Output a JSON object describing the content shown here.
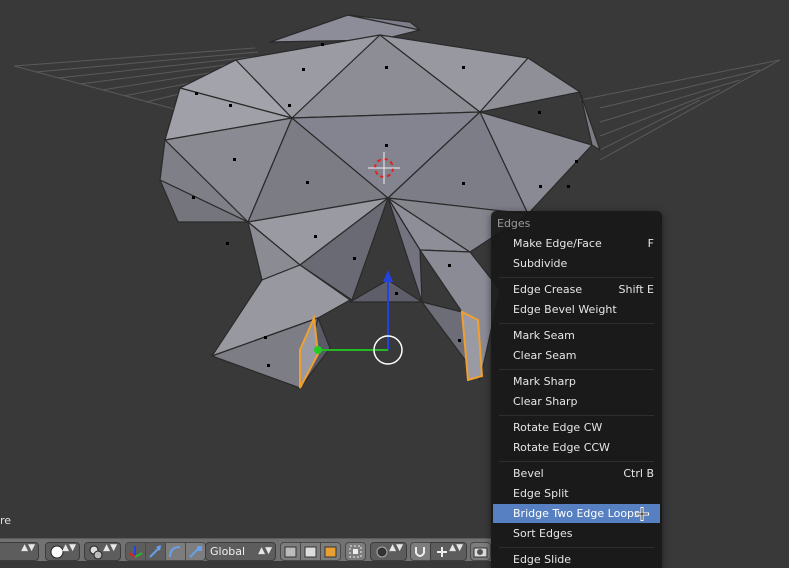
{
  "viewport": {
    "partial_label": "re"
  },
  "menu": {
    "title": "Edges",
    "items": [
      {
        "label": "Make Edge/Face",
        "shortcut": "F"
      },
      {
        "label": "Subdivide",
        "shortcut": ""
      },
      {
        "label": "Edge Crease",
        "shortcut": "Shift E"
      },
      {
        "label": "Edge Bevel Weight",
        "shortcut": ""
      },
      {
        "label": "Mark Seam",
        "shortcut": ""
      },
      {
        "label": "Clear Seam",
        "shortcut": ""
      },
      {
        "label": "Mark Sharp",
        "shortcut": ""
      },
      {
        "label": "Clear Sharp",
        "shortcut": ""
      },
      {
        "label": "Rotate Edge CW",
        "shortcut": ""
      },
      {
        "label": "Rotate Edge CCW",
        "shortcut": ""
      },
      {
        "label": "Bevel",
        "shortcut": "Ctrl B"
      },
      {
        "label": "Edge Split",
        "shortcut": ""
      },
      {
        "label": "Bridge Two Edge Loops",
        "shortcut": ""
      },
      {
        "label": "Sort Edges",
        "shortcut": ""
      },
      {
        "label": "Edge Slide",
        "shortcut": ""
      }
    ],
    "highlighted": "Bridge Two Edge Loops"
  },
  "toolbar": {
    "orientation": "Global",
    "icons": [
      "viewport-shading-icon",
      "pivot-point-icon",
      "manipulator-icon",
      "translate-icon",
      "rotate-icon",
      "scale-icon",
      "solid-icon",
      "wire-icon",
      "texture-icon",
      "occlude-icon",
      "proportional-icon",
      "snap-icon",
      "magnet-icon",
      "render-icon"
    ]
  },
  "colors": {
    "menu_highlight": "#5680c2",
    "viewport_bg": "#393939",
    "selected_face": "#f0a030"
  }
}
